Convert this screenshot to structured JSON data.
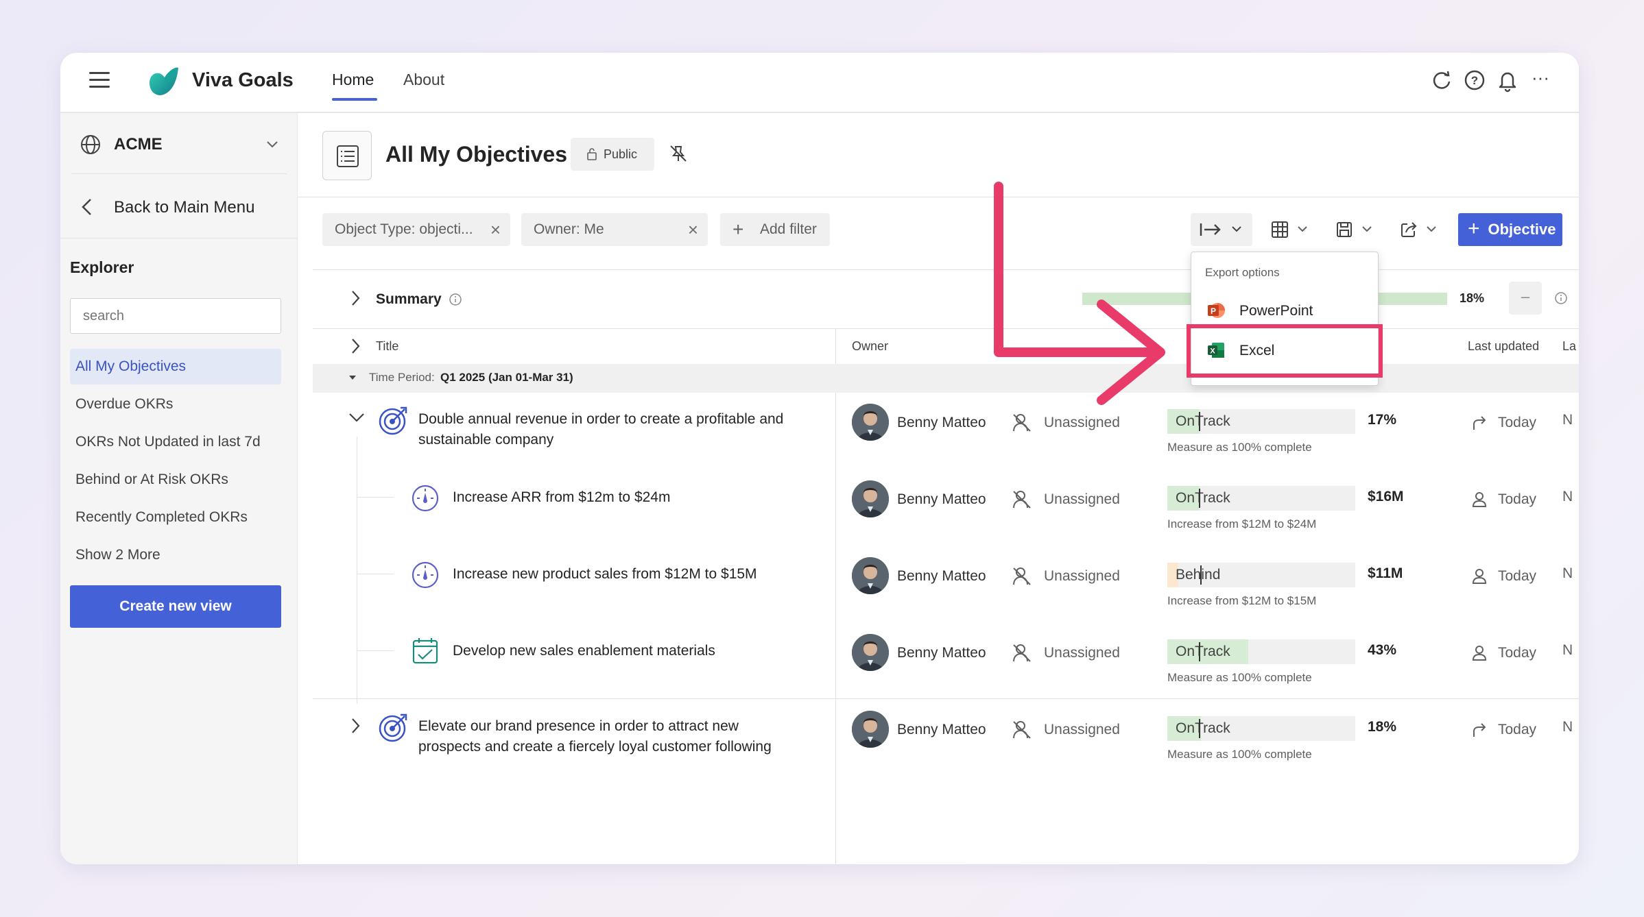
{
  "app": {
    "title": "Viva Goals"
  },
  "topnav": {
    "home": "Home",
    "about": "About"
  },
  "sidebar": {
    "org": "ACME",
    "back": "Back to Main Menu",
    "explorer": "Explorer",
    "search_placeholder": "search",
    "items": [
      {
        "label": "All My Objectives"
      },
      {
        "label": "Overdue OKRs"
      },
      {
        "label": "OKRs Not Updated in last 7d"
      },
      {
        "label": "Behind or At Risk OKRs"
      },
      {
        "label": "Recently Completed OKRs"
      },
      {
        "label": "Show 2 More"
      }
    ],
    "create_view": "Create new view"
  },
  "page": {
    "title": "All My Objectives",
    "visibility": "Public"
  },
  "filters": {
    "object_type": "Object Type: objecti...",
    "owner": "Owner: Me",
    "add_filter": "Add filter"
  },
  "toolbar": {
    "objective_button": "Objective"
  },
  "export_menu": {
    "header": "Export options",
    "items": [
      {
        "label": "PowerPoint"
      },
      {
        "label": "Excel"
      }
    ]
  },
  "summary": {
    "label": "Summary",
    "percent": "18%",
    "progress": 0.18
  },
  "columns": {
    "title": "Title",
    "owner": "Owner",
    "last_updated": "Last updated",
    "la": "La"
  },
  "time_period": {
    "label": "Time Period:",
    "value": "Q1 2025 (Jan 01-Mar 31)"
  },
  "rows": [
    {
      "title_line1": "Double annual revenue in order to create a profitable and",
      "title_line2": "sustainable company",
      "owner": "Benny Matteo",
      "assignee": "Unassigned",
      "status_a": "On",
      "status_b": "Track",
      "status_color": "#d6ecd4",
      "progress": 0.17,
      "value": "17%",
      "sub": "Measure as 100% complete",
      "updated": "Today",
      "n": "N"
    },
    {
      "title_line1": "Increase ARR from $12m to $24m",
      "owner": "Benny Matteo",
      "assignee": "Unassigned",
      "status_a": "On",
      "status_b": "Track",
      "status_color": "#d6ecd4",
      "progress": 0.17,
      "value": "$16M",
      "sub": "Increase from $12M to $24M",
      "updated": "Today",
      "n": "N"
    },
    {
      "title_line1": "Increase new product sales from $12M to $15M",
      "owner": "Benny Matteo",
      "assignee": "Unassigned",
      "status_a": "Beh",
      "status_b": "ind",
      "status_color": "#fbe8cf",
      "progress": 0.06,
      "value": "$11M",
      "sub": "Increase from $12M to $15M",
      "updated": "Today",
      "n": "N"
    },
    {
      "title_line1": "Develop new sales enablement materials",
      "owner": "Benny Matteo",
      "assignee": "Unassigned",
      "status_a": "On",
      "status_b": "Track",
      "status_color": "#d6ecd4",
      "progress": 0.43,
      "value": "43%",
      "sub": "Measure as 100% complete",
      "updated": "Today",
      "n": "N"
    },
    {
      "title_line1": "Elevate our brand presence in order to attract new",
      "title_line2": "prospects and create a fiercely loyal customer following",
      "owner": "Benny Matteo",
      "assignee": "Unassigned",
      "status_a": "On",
      "status_b": "Track",
      "status_color": "#d6ecd4",
      "progress": 0.18,
      "value": "18%",
      "sub": "Measure as 100% complete",
      "updated": "Today",
      "n": "N"
    }
  ],
  "colors": {
    "accent": "#4461d8",
    "annotation": "#e83b6a",
    "on_track": "#d6ecd4",
    "behind": "#fbe8cf"
  }
}
